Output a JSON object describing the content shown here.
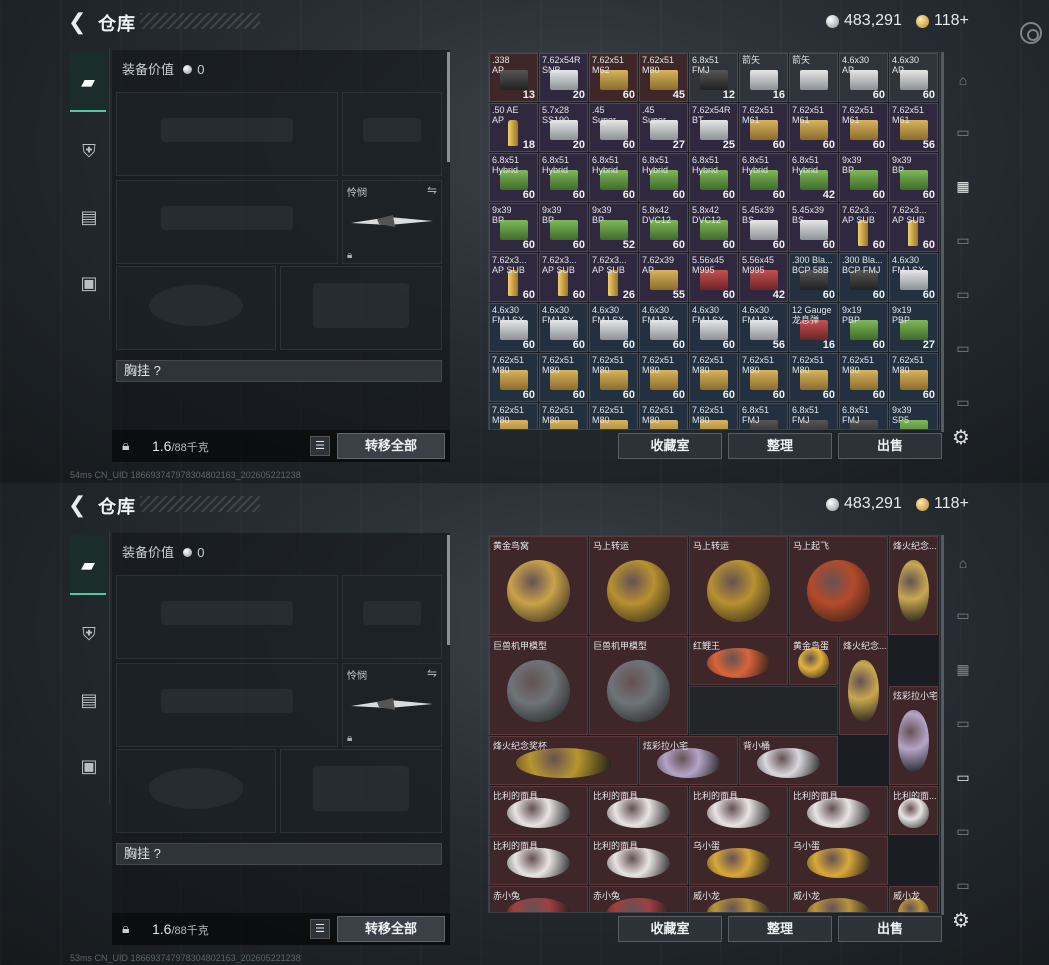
{
  "header": {
    "title": "仓库",
    "currency_silver": "483,291",
    "currency_gold": "118+"
  },
  "equipment": {
    "value_label": "装备价值",
    "value": "0",
    "melee_label": "怜悯",
    "chest_rig_label": "胸挂",
    "chest_rig_help": "?",
    "weight": "1.6",
    "weight_capacity": "/88千克",
    "transfer_all": "转移全部"
  },
  "actions": {
    "collection": "收藏室",
    "sort": "整理",
    "sell": "出售"
  },
  "footer": {
    "status_top": "54ms  CN_UID 18669374797830480216​3_202605221238",
    "status_bottom": "53ms  CN_UID 18669374797830480216​3_202605221238"
  },
  "ammo_grid": [
    [
      {
        "n": ".338\nAP",
        "c": "13",
        "t": "red",
        "b": "blk"
      },
      {
        "n": "7.62x54R\nSNB",
        "c": "20",
        "t": "purple",
        "b": "wht"
      },
      {
        "n": "7.62x51\nM62",
        "c": "60",
        "t": "red",
        "b": "mil"
      },
      {
        "n": "7.62x51\nM80",
        "c": "45",
        "t": "red",
        "b": "mil"
      },
      {
        "n": "6.8x51\nFMJ",
        "c": "12",
        "t": "",
        "b": "blk"
      },
      {
        "n": "箭矢\n",
        "c": "16",
        "t": "",
        "b": "wht"
      },
      {
        "n": "箭矢\n",
        "c": "",
        "t": "",
        "b": "wht"
      },
      {
        "n": "4.6x30\nAP",
        "c": "60",
        "t": "",
        "b": "wht"
      },
      {
        "n": "4.6x30\nAP",
        "c": "60",
        "t": "",
        "b": "wht"
      }
    ],
    [
      {
        "n": ".50 AE\nAP",
        "c": "18",
        "t": "purple",
        "b": "brs"
      },
      {
        "n": "5.7x28\nSS190",
        "c": "20",
        "t": "purple",
        "b": "wht"
      },
      {
        "n": ".45\nSuper",
        "c": "60",
        "t": "purple",
        "b": "wht"
      },
      {
        "n": ".45\nSuper",
        "c": "27",
        "t": "purple",
        "b": "wht"
      },
      {
        "n": "7.62x54R\nBT",
        "c": "25",
        "t": "purple",
        "b": "wht"
      },
      {
        "n": "7.62x51\nM61",
        "c": "60",
        "t": "purple",
        "b": "mil"
      },
      {
        "n": "7.62x51\nM61",
        "c": "60",
        "t": "purple",
        "b": "mil"
      },
      {
        "n": "7.62x51\nM61",
        "c": "60",
        "t": "purple",
        "b": "mil"
      },
      {
        "n": "7.62x51\nM61",
        "c": "56",
        "t": "purple",
        "b": "mil"
      }
    ],
    [
      {
        "n": "6.8x51\nHybrid",
        "c": "60",
        "t": "purple",
        "b": "grn"
      },
      {
        "n": "6.8x51\nHybrid",
        "c": "60",
        "t": "purple",
        "b": "grn"
      },
      {
        "n": "6.8x51\nHybrid",
        "c": "60",
        "t": "purple",
        "b": "grn"
      },
      {
        "n": "6.8x51\nHybrid",
        "c": "60",
        "t": "purple",
        "b": "grn"
      },
      {
        "n": "6.8x51\nHybrid",
        "c": "60",
        "t": "purple",
        "b": "grn"
      },
      {
        "n": "6.8x51\nHybrid",
        "c": "60",
        "t": "purple",
        "b": "grn"
      },
      {
        "n": "6.8x51\nHybrid",
        "c": "42",
        "t": "purple",
        "b": "grn"
      },
      {
        "n": "9x39\nBP",
        "c": "60",
        "t": "purple",
        "b": "grn"
      },
      {
        "n": "9x39\nBP",
        "c": "60",
        "t": "purple",
        "b": "grn"
      }
    ],
    [
      {
        "n": "9x39\nBP",
        "c": "60",
        "t": "purple",
        "b": "grn"
      },
      {
        "n": "9x39\nBP",
        "c": "60",
        "t": "purple",
        "b": "grn"
      },
      {
        "n": "9x39\nBP",
        "c": "52",
        "t": "purple",
        "b": "grn"
      },
      {
        "n": "5.8x42\nDVC12",
        "c": "60",
        "t": "purple",
        "b": "grn"
      },
      {
        "n": "5.8x42\nDVC12",
        "c": "60",
        "t": "purple",
        "b": "grn"
      },
      {
        "n": "5.45x39\nBS",
        "c": "60",
        "t": "purple",
        "b": "wht"
      },
      {
        "n": "5.45x39\nBS",
        "c": "60",
        "t": "purple",
        "b": "wht"
      },
      {
        "n": "7.62x3...\nAP SUB",
        "c": "60",
        "t": "purple",
        "b": "brs"
      },
      {
        "n": "7.62x3...\nAP SUB",
        "c": "60",
        "t": "purple",
        "b": "brs"
      }
    ],
    [
      {
        "n": "7.62x3...\nAP SUB",
        "c": "60",
        "t": "purple",
        "b": "brs"
      },
      {
        "n": "7.62x3...\nAP SUB",
        "c": "60",
        "t": "purple",
        "b": "brs"
      },
      {
        "n": "7.62x3...\nAP SUB",
        "c": "26",
        "t": "purple",
        "b": "brs"
      },
      {
        "n": "7.62x39\nAP",
        "c": "55",
        "t": "purple",
        "b": "mil"
      },
      {
        "n": "5.56x45\nM995",
        "c": "60",
        "t": "purple",
        "b": "red"
      },
      {
        "n": "5.56x45\nM995",
        "c": "42",
        "t": "purple",
        "b": "red"
      },
      {
        "n": ".300 Bla...\nBCP 58B",
        "c": "60",
        "t": "blue",
        "b": "blk"
      },
      {
        "n": ".300 Bla...\nBCP FMJ",
        "c": "60",
        "t": "blue",
        "b": "blk"
      },
      {
        "n": "4.6x30\nFMJ SX",
        "c": "60",
        "t": "blue",
        "b": "wht"
      }
    ],
    [
      {
        "n": "4.6x30\nFMJ SX",
        "c": "60",
        "t": "blue",
        "b": "wht"
      },
      {
        "n": "4.6x30\nFMJ SX",
        "c": "60",
        "t": "blue",
        "b": "wht"
      },
      {
        "n": "4.6x30\nFMJ SX",
        "c": "60",
        "t": "blue",
        "b": "wht"
      },
      {
        "n": "4.6x30\nFMJ SX",
        "c": "60",
        "t": "blue",
        "b": "wht"
      },
      {
        "n": "4.6x30\nFMJ SX",
        "c": "60",
        "t": "blue",
        "b": "wht"
      },
      {
        "n": "4.6x30\nFMJ SX",
        "c": "56",
        "t": "blue",
        "b": "wht"
      },
      {
        "n": "12 Gauge\n龙息弹",
        "c": "16",
        "t": "blue",
        "b": "red"
      },
      {
        "n": "9x19\nPBP",
        "c": "60",
        "t": "blue",
        "b": "grn"
      },
      {
        "n": "9x19\nPBP",
        "c": "27",
        "t": "blue",
        "b": "grn"
      }
    ],
    [
      {
        "n": "7.62x51\nM80",
        "c": "60",
        "t": "blue",
        "b": "mil"
      },
      {
        "n": "7.62x51\nM80",
        "c": "60",
        "t": "blue",
        "b": "mil"
      },
      {
        "n": "7.62x51\nM80",
        "c": "60",
        "t": "blue",
        "b": "mil"
      },
      {
        "n": "7.62x51\nM80",
        "c": "60",
        "t": "blue",
        "b": "mil"
      },
      {
        "n": "7.62x51\nM80",
        "c": "60",
        "t": "blue",
        "b": "mil"
      },
      {
        "n": "7.62x51\nM80",
        "c": "60",
        "t": "blue",
        "b": "mil"
      },
      {
        "n": "7.62x51\nM80",
        "c": "60",
        "t": "blue",
        "b": "mil"
      },
      {
        "n": "7.62x51\nM80",
        "c": "60",
        "t": "blue",
        "b": "mil"
      },
      {
        "n": "7.62x51\nM80",
        "c": "60",
        "t": "blue",
        "b": "mil"
      }
    ],
    [
      {
        "n": "7.62x51\nM80",
        "c": "",
        "t": "blue",
        "b": "mil"
      },
      {
        "n": "7.62x51\nM80",
        "c": "",
        "t": "blue",
        "b": "mil"
      },
      {
        "n": "7.62x51\nM80",
        "c": "",
        "t": "blue",
        "b": "mil"
      },
      {
        "n": "7.62x51\nM80",
        "c": "",
        "t": "blue",
        "b": "mil"
      },
      {
        "n": "7.62x51\nM80",
        "c": "",
        "t": "blue",
        "b": "mil"
      },
      {
        "n": "6.8x51\nFMJ",
        "c": "",
        "t": "blue",
        "b": "blk"
      },
      {
        "n": "6.8x51\nFMJ",
        "c": "",
        "t": "blue",
        "b": "blk"
      },
      {
        "n": "6.8x51\nFMJ",
        "c": "",
        "t": "blue",
        "b": "blk"
      },
      {
        "n": "9x39\nSP5",
        "c": "",
        "t": "blue",
        "b": "grn"
      }
    ]
  ],
  "collectibles": [
    {
      "name": "黄金鸟窝",
      "art": "#c9a24a"
    },
    {
      "name": "马上转运",
      "art": "#b8912f"
    },
    {
      "name": "马上转运",
      "art": "#b8912f"
    },
    {
      "name": "马上起飞",
      "art": "#b54a2a"
    },
    {
      "name": "烽火纪念...",
      "art": "#c8a850"
    },
    {
      "name": "巨兽机甲模型",
      "art": "#6e7478"
    },
    {
      "name": "巨兽机甲模型",
      "art": "#6e7478"
    },
    {
      "name": "红鲤王",
      "art": "#d9643a"
    },
    {
      "name": "黄金鸟蛋",
      "art": "#e2b23a"
    },
    {
      "name": "烽火纪念...",
      "art": "#c8a850"
    },
    {
      "name": "炫彩拉小宅",
      "art": "#b4a4c8"
    },
    {
      "name": "烽火纪念奖杯",
      "art": "#b8962e"
    },
    {
      "name": "炫彩拉小宅",
      "art": "#b4a4c8"
    },
    {
      "name": "背小桶",
      "art": "#d8d8de"
    },
    {
      "name": "比利的面具...",
      "art": "#e8e4e4"
    },
    {
      "name": "比利的面具...",
      "art": "#e8e4e4"
    },
    {
      "name": "比利的面具...",
      "art": "#e8e4e4"
    },
    {
      "name": "比利的面具...",
      "art": "#e8e4e4"
    },
    {
      "name": "比利的面...",
      "art": "#e8e4e4"
    },
    {
      "name": "比利的面具...",
      "art": "#e8e4e4"
    },
    {
      "name": "比利的面具...",
      "art": "#e8e4e4"
    },
    {
      "name": "乌小蛋",
      "art": "#d9a83a"
    },
    {
      "name": "乌小蛋",
      "art": "#d9a83a"
    },
    {
      "name": "赤小兔",
      "art": "#a04040"
    },
    {
      "name": "赤小兔",
      "art": "#a04040"
    },
    {
      "name": "威小龙",
      "art": "#b8963a"
    },
    {
      "name": "威小龙",
      "art": "#b8963a"
    },
    {
      "name": "威小龙",
      "art": "#b8963a"
    }
  ]
}
